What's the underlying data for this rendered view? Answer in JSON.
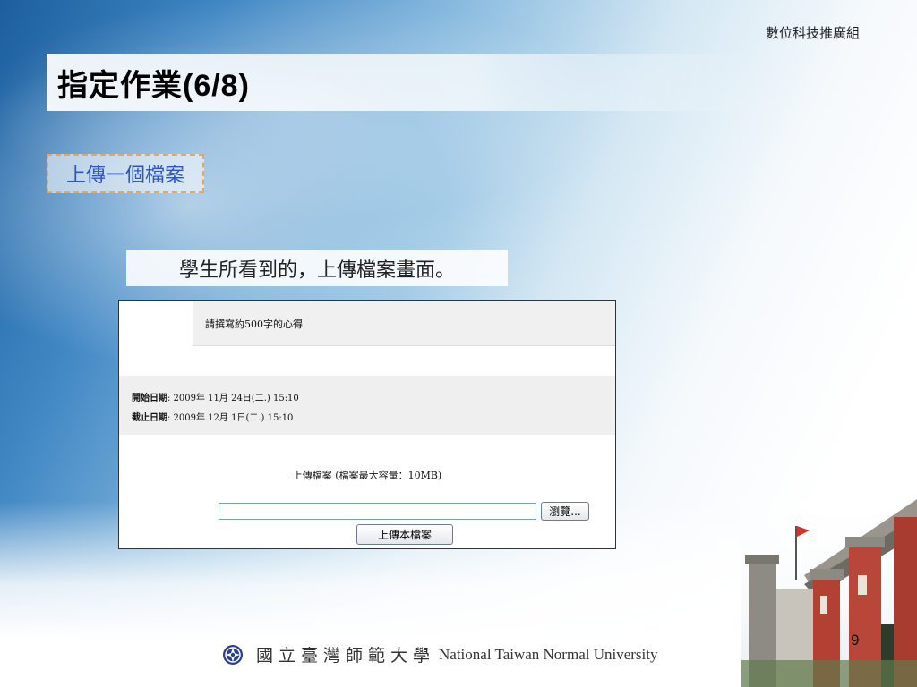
{
  "slide": {
    "org_label": "數位科技推廣組",
    "title": "指定作業(6/8)",
    "section_label": "上傳一個檔案",
    "caption": "學生所看到的，上傳檔案畫面。",
    "page_number": "9"
  },
  "screenshot": {
    "prompt_text": "請撰寫約500字的心得",
    "start_label": "開始日期",
    "start_value": ": 2009年 11月 24日(二.) 15:10",
    "end_label": "截止日期",
    "end_value": ": 2009年 12月 1日(二.) 15:10",
    "upload_label": "上傳檔案 (檔案最大容量：10MB)",
    "file_input_value": "",
    "browse_label": "瀏覽...",
    "upload_button_label": "上傳本檔案"
  },
  "footer": {
    "university_zh": "國立臺灣師範大學",
    "university_en": "National Taiwan Normal University"
  },
  "colors": {
    "section_text": "#2f54c6",
    "section_border": "#e3a760",
    "seal_blue": "#2a3f8f"
  }
}
